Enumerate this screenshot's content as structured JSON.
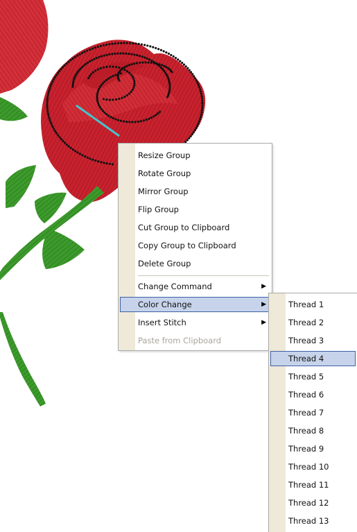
{
  "context_menu": {
    "items": [
      {
        "label": "Resize Group"
      },
      {
        "label": "Rotate Group"
      },
      {
        "label": "Mirror Group"
      },
      {
        "label": "Flip Group"
      },
      {
        "label": "Cut Group to Clipboard"
      },
      {
        "label": "Copy Group to Clipboard"
      },
      {
        "label": "Delete Group"
      },
      {
        "label": "Change Command",
        "submenu": true
      },
      {
        "label": "Color Change",
        "submenu": true,
        "highlighted": true
      },
      {
        "label": "Insert Stitch",
        "submenu": true
      },
      {
        "label": "Paste from Clipboard",
        "disabled": true
      }
    ]
  },
  "color_submenu": {
    "items": [
      {
        "label": "Thread 1"
      },
      {
        "label": "Thread 2"
      },
      {
        "label": "Thread 3"
      },
      {
        "label": "Thread 4",
        "highlighted": true
      },
      {
        "label": "Thread 5"
      },
      {
        "label": "Thread 6"
      },
      {
        "label": "Thread 7"
      },
      {
        "label": "Thread 8"
      },
      {
        "label": "Thread 9"
      },
      {
        "label": "Thread 10"
      },
      {
        "label": "Thread 11"
      },
      {
        "label": "Thread 12"
      },
      {
        "label": "Thread 13"
      }
    ]
  },
  "icons": {
    "submenu_arrow": "triangle-right-icon"
  },
  "colors": {
    "rose_red": "#c8222e",
    "leaf_green": "#3d9a2c",
    "stitch_black": "#111111",
    "highlight_fill": "#c6d3ea",
    "highlight_border": "#3e5fa6",
    "gutter": "#efe9d9"
  }
}
